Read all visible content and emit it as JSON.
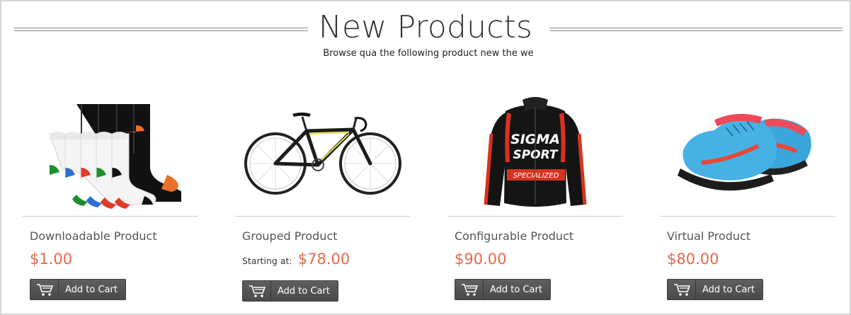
{
  "header": {
    "title": "New Products",
    "subtitle": "Browse qua the following product new the we"
  },
  "products": [
    {
      "name": "Downloadable Product",
      "price_prefix": "",
      "price": "$1.00",
      "image": "socks-image",
      "button_label": "Add to Cart"
    },
    {
      "name": "Grouped Product",
      "price_prefix": "Starting at:",
      "price": "$78.00",
      "image": "bicycle-image",
      "button_label": "Add to Cart"
    },
    {
      "name": "Configurable Product",
      "price_prefix": "",
      "price": "$90.00",
      "image": "jacket-image",
      "button_label": "Add to Cart"
    },
    {
      "name": "Virtual Product",
      "price_prefix": "",
      "price": "$80.00",
      "image": "shoes-image",
      "button_label": "Add to Cart"
    }
  ],
  "colors": {
    "price": "#e3694c",
    "button_bg": "#555555",
    "divider": "#cfcfcf"
  },
  "icons": {
    "cart": "shopping-cart-icon"
  }
}
